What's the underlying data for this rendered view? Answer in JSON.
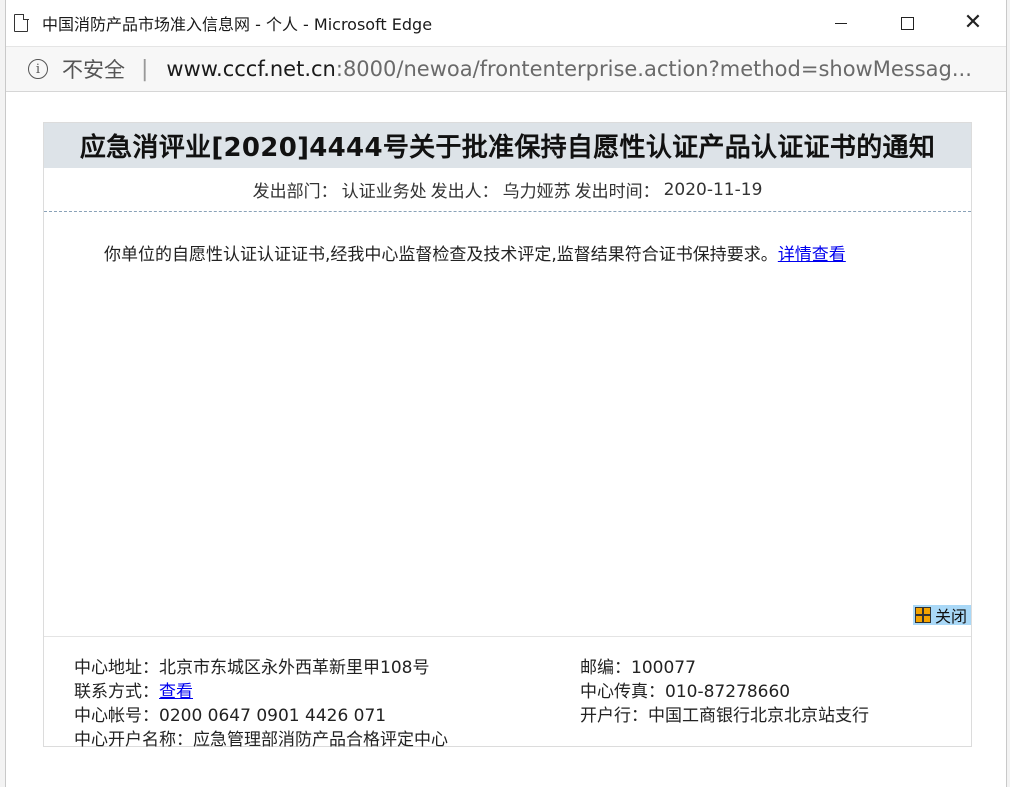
{
  "window": {
    "title": "中国消防产品市场准入信息网 - 个人 - Microsoft Edge",
    "icon": "page-icon"
  },
  "addressbar": {
    "security_label": "不安全",
    "separator": "|",
    "url_host": "www.cccf.net.cn",
    "url_rest": ":8000/newoa/frontenterprise.action?method=showMessag..."
  },
  "notice": {
    "title": "应急消评业[2020]4444号关于批准保持自愿性认证产品认证证书的通知",
    "department_label": "发出部门：",
    "department": "认证业务处",
    "sender_label": "发出人：",
    "sender": "乌力娅苏",
    "time_label": "发出时间：",
    "time": "2020-11-19",
    "body": "你单位的自愿性认证认证证书,经我中心监督检查及技术评定,监督结果符合证书保持要求。",
    "details_link": "详情查看"
  },
  "close_button": {
    "label": "关闭",
    "icon": "grid-icon"
  },
  "footer": {
    "address_label": "中心地址：",
    "address": "北京市东城区永外西革新里甲108号",
    "postcode_label": "邮编：",
    "postcode": "100077",
    "contact_label": "联系方式：",
    "contact_link": "查看",
    "fax_label": "中心传真：",
    "fax": "010-87278660",
    "account_label": "中心帐号：",
    "account": "0200 0647 0901 4426 071",
    "bank_label": "开户行：",
    "bank": "中国工商银行北京北京站支行",
    "account_name_label": "中心开户名称：",
    "account_name": "应急管理部消防产品合格评定中心"
  },
  "colors": {
    "title_bg": "#dde3e8",
    "link": "#0000ee",
    "close_bg": "#a9d8f7",
    "dashed_divider": "#8aa2b8"
  }
}
